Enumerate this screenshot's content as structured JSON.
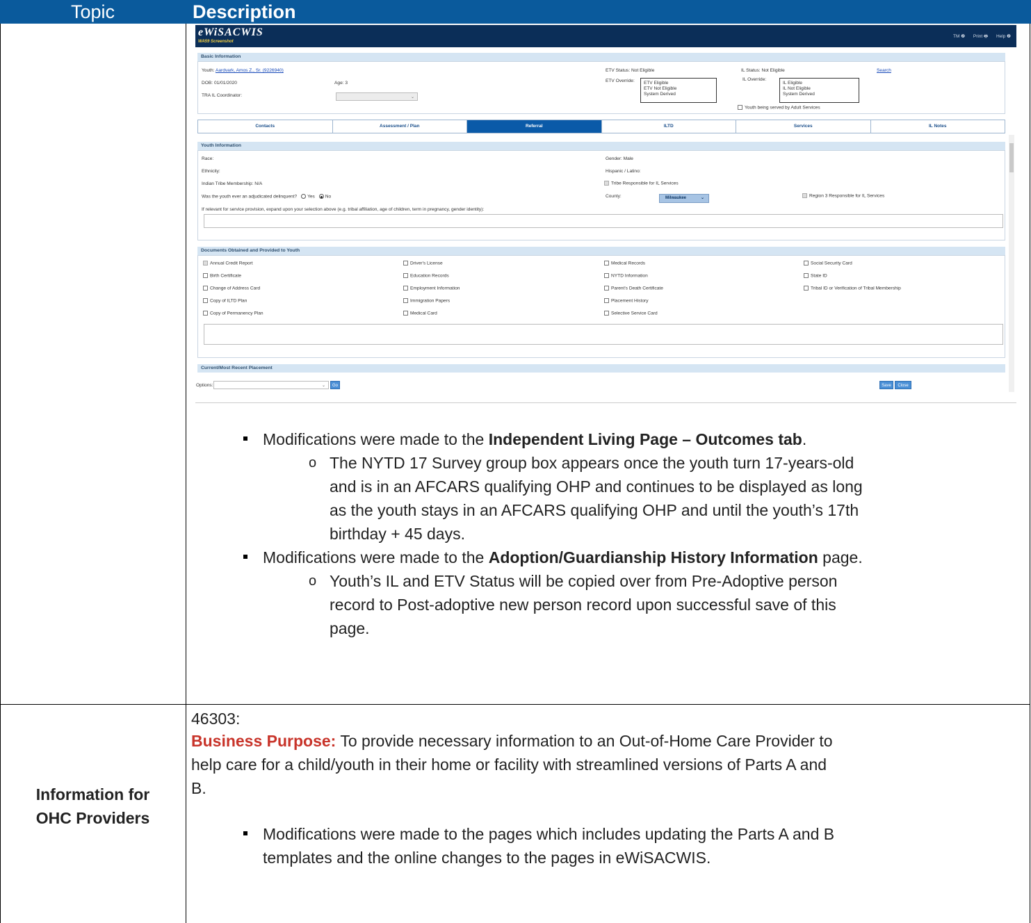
{
  "table": {
    "header_topic": "Topic",
    "header_description": "Description"
  },
  "screen": {
    "brand": "eWiSACWIS",
    "screen_id": "WA59 Screenshot",
    "toolbar": {
      "tm": "TM ❷",
      "print": "Print 🖶",
      "help": "Help ❷"
    },
    "basic": {
      "title": "Basic Information",
      "youth_label": "Youth:",
      "youth_link": "Aardvark, Amos Z., Sr. (9226940)",
      "dob": "DOB: 01/01/2020",
      "age": "Age: 3",
      "coordinator": "TRA IL Coordinator:",
      "etv_status": "ETV Status: Not Eligible",
      "etv_override": "ETV Override:",
      "etv_options": [
        "ETV Eligible",
        "ETV Not Eligible",
        "System Derived"
      ],
      "il_status": "IL Status:  Not Eligible",
      "il_override": "IL Override:",
      "il_options": [
        "IL   Eligible",
        "IL   Not Eligible",
        "System Derived"
      ],
      "search": "Search",
      "adult_services": "Youth being served by Adult Services"
    },
    "tabs": [
      "Contacts",
      "Assessment / Plan",
      "Referral",
      "ILTD",
      "Services",
      "IL Notes"
    ],
    "youth": {
      "title": "Youth Information",
      "race": "Race:",
      "gender": "Gender: Male",
      "ethnicity": "Ethnicity:",
      "hispanic": "Hispanic / Latino:",
      "tribe": "Indian Tribe Membership: N/A",
      "tribe_resp": "Tribe Responsible for IL Services",
      "delinquent": "Was the youth ever an adjudicated delinquent?",
      "yes": "Yes",
      "no": "No",
      "county_label": "County:",
      "county_value": "Milwaukee",
      "region": "Region 3 Responsible for IL Services",
      "expand": "If relevant for service provision, expand upon your selection above (e.g. tribal affiliation, age of children, term in pregnancy, gender identity):"
    },
    "docs": {
      "title": "Documents Obtained and Provided to Youth",
      "col1": [
        "Annual Credit Report",
        "Birth Certificate",
        "Change of Address Card",
        "Copy of ILTD Plan",
        "Copy of Permanency Plan"
      ],
      "col2": [
        "Driver's License",
        "Education Records",
        "Employment Information",
        "Immigration Papers",
        "Medical Card"
      ],
      "col3": [
        "Medical Records",
        "NYTD Information",
        "Parent's Death Certificate",
        "Placement History",
        "Selective Service Card"
      ],
      "col4": [
        "Social Security Card",
        "State ID",
        "Tribal ID or Verification of Tribal Membership"
      ]
    },
    "placement": {
      "title": "Current/Most Recent Placement"
    },
    "footer": {
      "options": "Options:",
      "go": "Go",
      "save": "Save",
      "close": "Close"
    }
  },
  "notes": {
    "b1_pre": "Modifications were made to the ",
    "b1_bold": "Independent Living Page – Outcomes tab",
    "b1_post": ".",
    "b1_sub": [
      "The NYTD 17 Survey group box appears once the youth turn 17-years-old",
      "and is in an AFCARS qualifying OHP and continues to be displayed as long",
      "as the youth stays in an AFCARS qualifying OHP and until the youth’s 17th",
      "birthday + 45 days."
    ],
    "b2_pre": "Modifications were made to the ",
    "b2_bold": "Adoption/Guardianship History Information",
    "b2_post": " page.",
    "b2_sub": [
      "Youth’s IL and ETV Status will be copied over from Pre-Adoptive person",
      "record to Post-adoptive new person record upon successful save of this",
      "page."
    ]
  },
  "row2": {
    "topic_line1": "Information for",
    "topic_line2": "OHC Providers",
    "id": "46303:",
    "purpose_label": "Business Purpose:",
    "purpose_text": [
      " To provide necessary information to an Out-of-Home Care Provider to",
      "help care for a child/youth in their home or facility with streamlined versions of Parts A and",
      "B."
    ],
    "bullet": [
      "Modifications were made to the pages which includes updating the Parts A and B",
      "templates and the online changes to the pages in eWiSACWIS."
    ]
  }
}
